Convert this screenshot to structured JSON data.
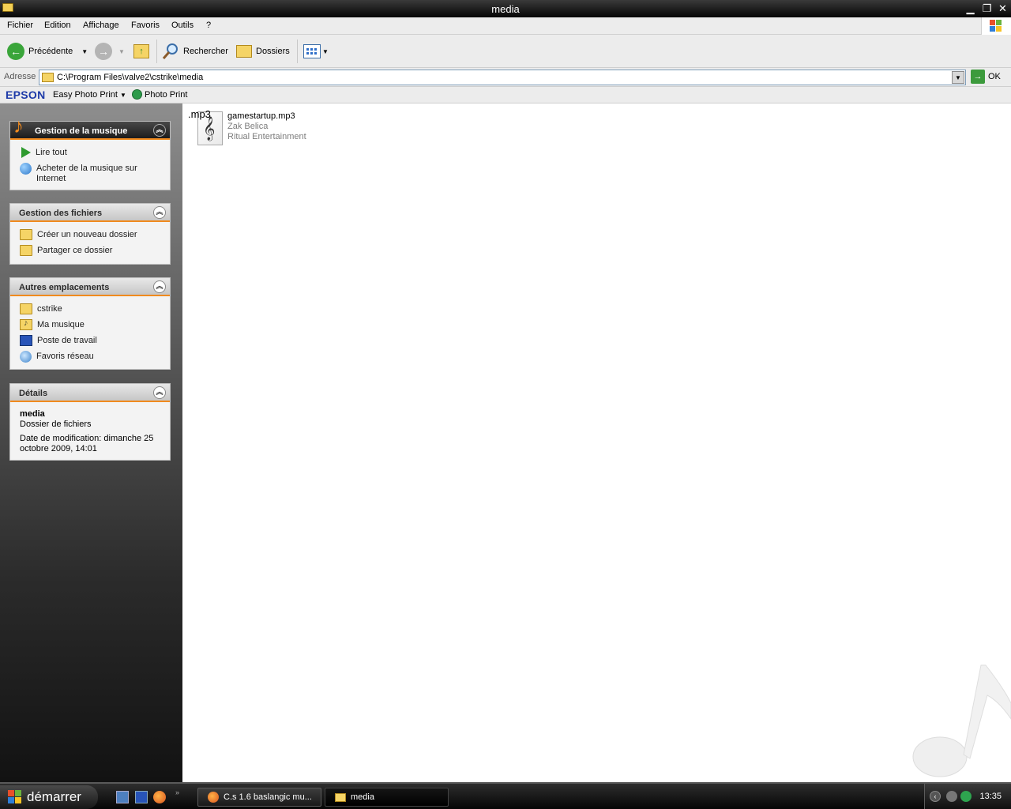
{
  "window": {
    "title": "media"
  },
  "menu": [
    "Fichier",
    "Edition",
    "Affichage",
    "Favoris",
    "Outils",
    "?"
  ],
  "toolbar": {
    "back_label": "Précédente",
    "search_label": "Rechercher",
    "folders_label": "Dossiers"
  },
  "address": {
    "label": "Adresse",
    "value": "C:\\Program Files\\valve2\\cstrike\\media",
    "go_label": "OK"
  },
  "epson": {
    "brand": "EPSON",
    "easy_photo_print": "Easy Photo Print",
    "photo_print": "Photo Print"
  },
  "panels": {
    "music": {
      "title": "Gestion de la musique",
      "items": [
        "Lire tout",
        "Acheter de la musique sur Internet"
      ]
    },
    "files": {
      "title": "Gestion des fichiers",
      "items": [
        "Créer un nouveau dossier",
        "Partager ce dossier"
      ]
    },
    "places": {
      "title": "Autres emplacements",
      "items": [
        "cstrike",
        "Ma musique",
        "Poste de travail",
        "Favoris réseau"
      ]
    },
    "details": {
      "title": "Détails",
      "name": "media",
      "type": "Dossier de fichiers",
      "modified": "Date de modification: dimanche 25 octobre 2009, 14:01"
    }
  },
  "file": {
    "ext_badge": ".mp3",
    "name": "gamestartup.mp3",
    "artist": "Zak Belica",
    "album": "Ritual Entertainment"
  },
  "taskbar": {
    "start_label": "démarrer",
    "tasks": [
      "C.s 1.6 baslangic mu...",
      "media"
    ],
    "clock": "13:35"
  },
  "colors": {
    "accent": "#f08a1e",
    "epson_brand": "#1d3aa8"
  }
}
